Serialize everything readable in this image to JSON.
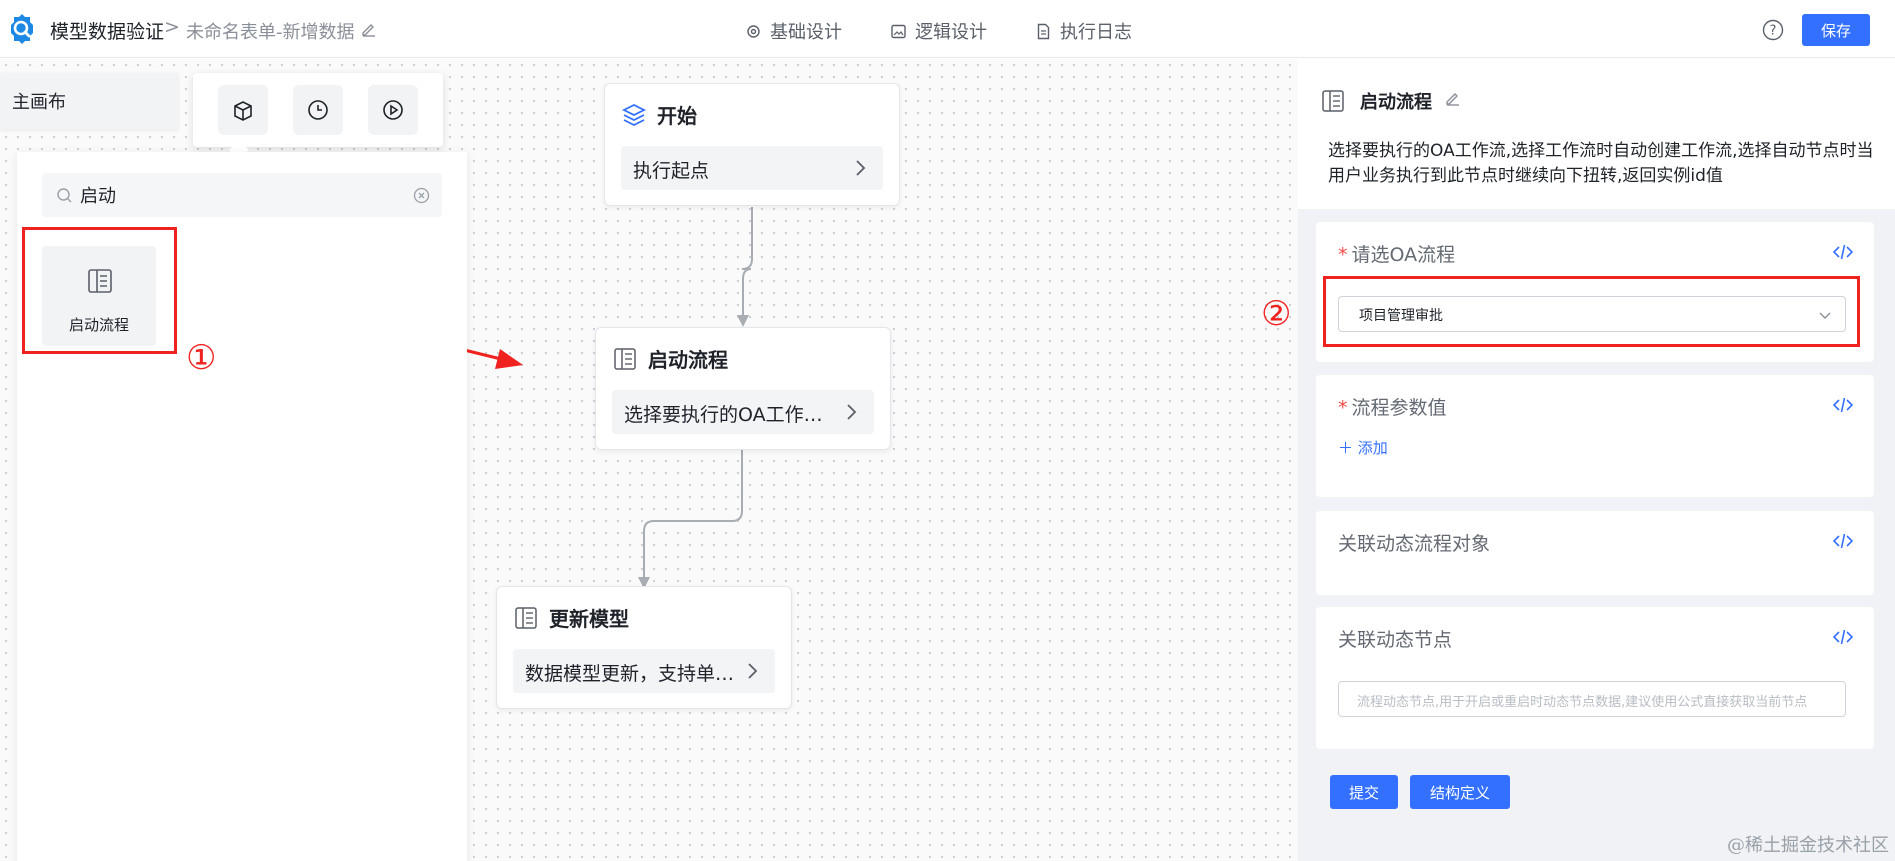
{
  "header": {
    "app_title": "模型数据验证",
    "crumb_separator": ">",
    "form_name": "未命名表单-新增数据",
    "tabs": [
      {
        "label": "基础设计"
      },
      {
        "label": "逻辑设计"
      },
      {
        "label": "执行日志"
      }
    ],
    "save_label": "保存"
  },
  "canvas": {
    "main_tab": "主画布",
    "toolbar_icons": [
      "box-icon",
      "clock-icon",
      "play-icon"
    ],
    "panel": {
      "search_value": "启动",
      "components": [
        {
          "label": "启动流程",
          "icon": "doc-list-icon"
        }
      ]
    },
    "annotations": {
      "mark_1": "①",
      "mark_2": "②"
    },
    "nodes": {
      "start": {
        "title": "开始",
        "body": "执行起点"
      },
      "launch": {
        "title": "启动流程",
        "body": "选择要执行的OA工作…"
      },
      "update": {
        "title": "更新模型",
        "body": "数据模型更新，支持单…"
      }
    }
  },
  "right_panel": {
    "title": "启动流程",
    "description": "选择要执行的OA工作流,选择工作流时自动创建工作流,选择自动节点时当用户业务执行到此节点时继续向下扭转,返回实例id值",
    "fields": {
      "oa_flow": {
        "required_mark": "*",
        "label": "请选OA流程",
        "value": "项目管理审批"
      },
      "flow_params": {
        "required_mark": "*",
        "label": "流程参数值",
        "add_label": "添加"
      },
      "dynamic_object": {
        "label": "关联动态流程对象"
      },
      "dynamic_node": {
        "label": "关联动态节点",
        "placeholder": "流程动态节点,用于开启或重启时动态节点数据,建议使用公式直接获取当前节点"
      }
    },
    "submit_label": "提交",
    "schema_label": "结构定义"
  },
  "watermark": "@稀土掘金技术社区",
  "colors": {
    "accent": "#3370ff",
    "annotation_red": "#f0221f",
    "required": "#f54a45"
  }
}
